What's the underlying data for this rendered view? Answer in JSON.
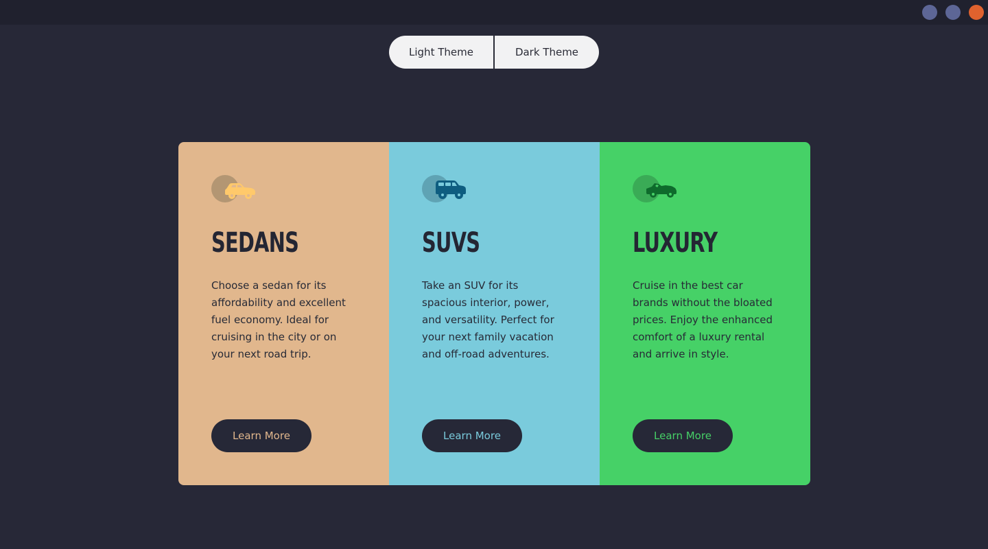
{
  "window": {
    "controls": [
      {
        "name": "window-control-1",
        "color": "#5d6696"
      },
      {
        "name": "window-control-2",
        "color": "#5d6696"
      },
      {
        "name": "window-control-close",
        "color": "#e0622e"
      }
    ]
  },
  "theme_switch": {
    "light_label": "Light Theme",
    "dark_label": "Dark Theme"
  },
  "cards": [
    {
      "id": "sedans",
      "title": "SEDANS",
      "description": "Choose a sedan for its affordability and excellent fuel economy. Ideal for cruising in the city or on your next road trip.",
      "button_label": "Learn More",
      "icon": "sedan-car-icon",
      "bg_color": "#e1b78d",
      "accent_color": "#ffc96b",
      "icon_circle_color": "#b39673",
      "button_text_color": "#e1b78d"
    },
    {
      "id": "suvs",
      "title": "SUVS",
      "description": "Take an SUV for its spacious interior, power, and versatility. Perfect for your next family vacation and off-road adventures.",
      "button_label": "Learn More",
      "icon": "suv-car-icon",
      "bg_color": "#7acbdc",
      "accent_color": "#0e5d80",
      "icon_circle_color": "#5fa3b4",
      "button_text_color": "#7acbdc"
    },
    {
      "id": "luxury",
      "title": "LUXURY",
      "description": "Cruise in the best car brands without the bloated prices. Enjoy the enhanced comfort of a luxury rental and arrive in style.",
      "button_label": "Learn More",
      "icon": "luxury-car-icon",
      "bg_color": "#46d167",
      "accent_color": "#0e6b2c",
      "icon_circle_color": "#3aab56",
      "button_text_color": "#46d167"
    }
  ]
}
